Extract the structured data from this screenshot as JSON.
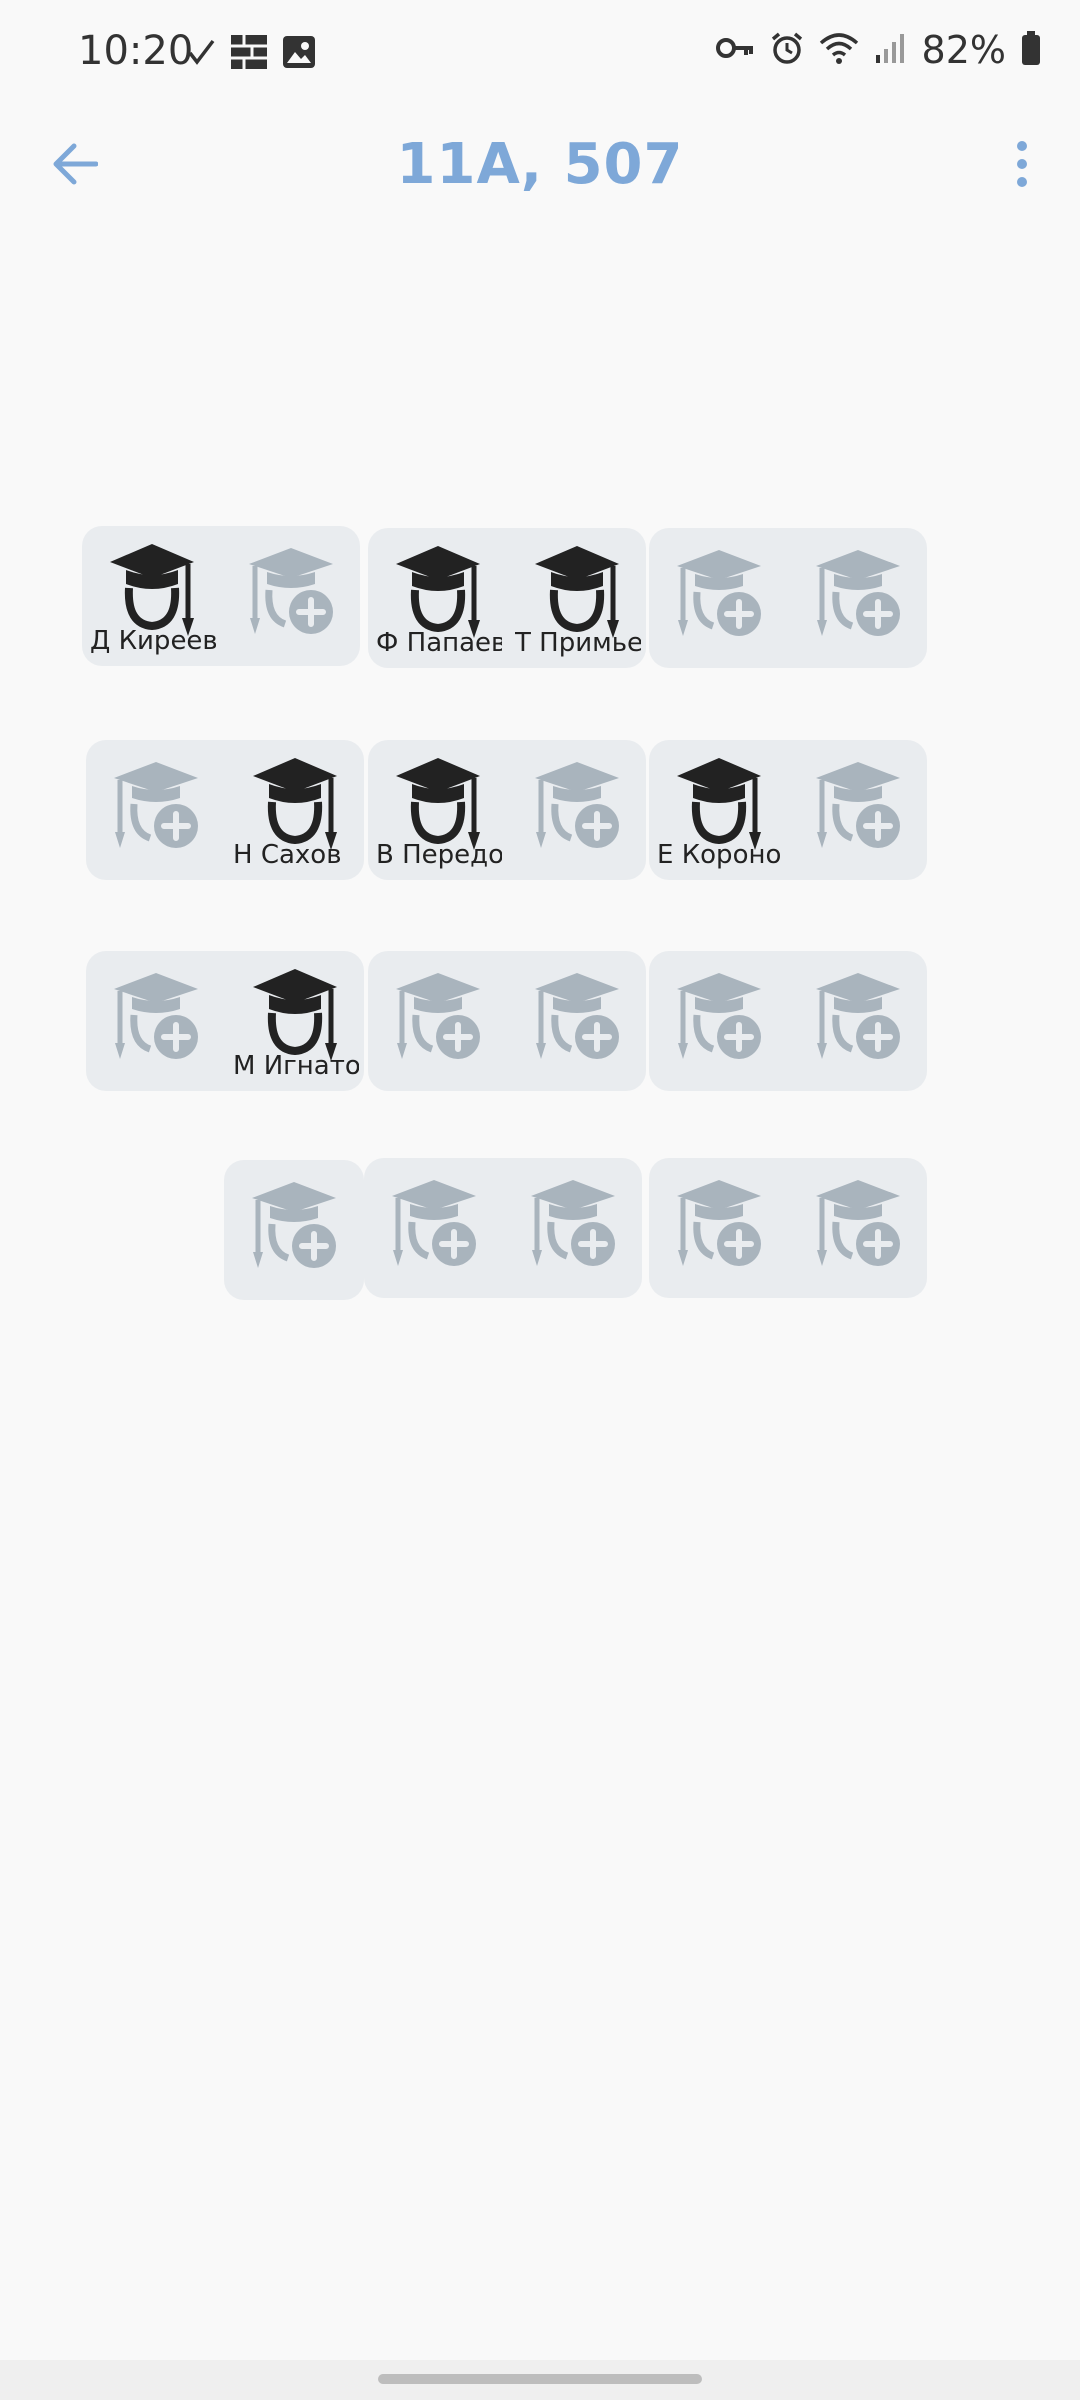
{
  "status_bar": {
    "time": "10:20",
    "left_icons": [
      "check-icon",
      "grid-icon",
      "image-icon"
    ],
    "right_icons": [
      "key-icon",
      "alarm-icon",
      "wifi-icon",
      "signal-icon",
      "battery-icon"
    ],
    "battery": "82%"
  },
  "app_bar": {
    "title": "11А, 507",
    "back_icon": "arrow-left-icon",
    "menu_icon": "more-vert-icon"
  },
  "colors": {
    "accent": "#7ea8d8",
    "desk_bg": "#e9ecef",
    "student_icon": "#222222",
    "empty_icon": "#a9b4bd"
  },
  "desks": [
    {
      "seats": [
        {
          "student": "Д Киреев"
        },
        {
          "student": null
        }
      ]
    },
    {
      "seats": [
        {
          "student": "Ф Папаев"
        },
        {
          "student": "Т Примьев"
        }
      ]
    },
    {
      "seats": [
        {
          "student": null
        },
        {
          "student": null
        }
      ]
    },
    {
      "seats": [
        {
          "student": null
        },
        {
          "student": "Н Сахов"
        }
      ]
    },
    {
      "seats": [
        {
          "student": "В Передов"
        },
        {
          "student": null
        }
      ]
    },
    {
      "seats": [
        {
          "student": "Е Коронов"
        },
        {
          "student": null
        }
      ]
    },
    {
      "seats": [
        {
          "student": null
        },
        {
          "student": "М Игнатов"
        }
      ]
    },
    {
      "seats": [
        {
          "student": null
        },
        {
          "student": null
        }
      ]
    },
    {
      "seats": [
        {
          "student": null
        },
        {
          "student": null
        }
      ]
    },
    {
      "seats": [
        {
          "student": null
        }
      ]
    },
    {
      "seats": [
        {
          "student": null
        },
        {
          "student": null
        }
      ]
    },
    {
      "seats": [
        {
          "student": null
        },
        {
          "student": null
        }
      ]
    }
  ]
}
